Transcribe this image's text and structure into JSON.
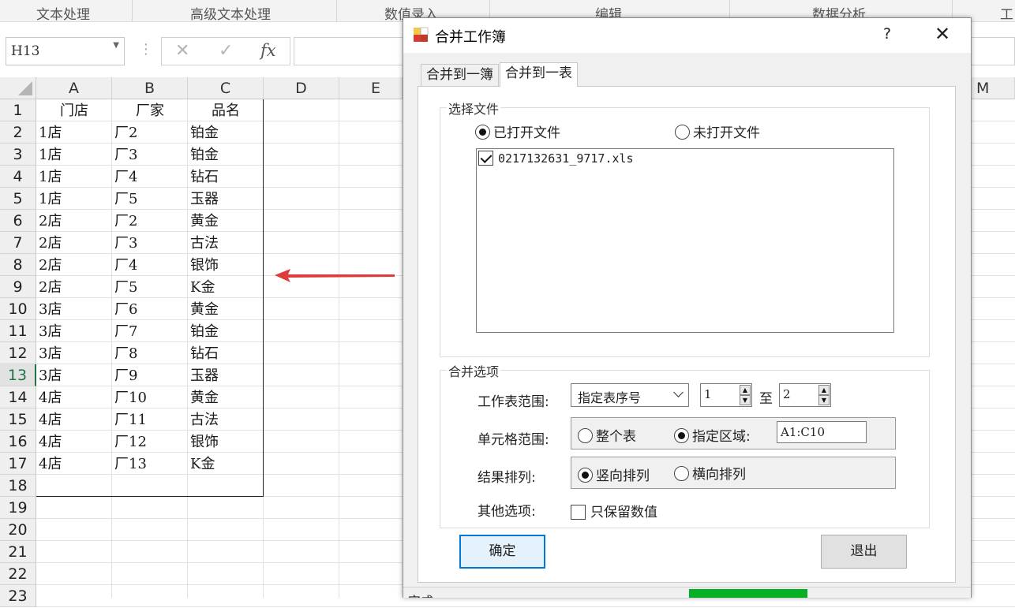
{
  "ribbon": {
    "tabs": [
      "文本处理",
      "高级文本处理",
      "数值录入",
      "编辑",
      "数据分析",
      "工"
    ]
  },
  "formula_bar": {
    "name_box": "H13",
    "cancel_glyph": "✕",
    "enter_glyph": "✓",
    "fx_label": "fx",
    "formula_value": ""
  },
  "sheet": {
    "columns": [
      "A",
      "B",
      "C",
      "D",
      "E",
      "M"
    ],
    "rows": [
      "1",
      "2",
      "3",
      "4",
      "5",
      "6",
      "7",
      "8",
      "9",
      "10",
      "11",
      "12",
      "13",
      "14",
      "15",
      "16",
      "17",
      "18",
      "19",
      "20",
      "21",
      "22",
      "23"
    ],
    "selected_row": "13",
    "header": [
      "门店",
      "厂家",
      "品名"
    ],
    "data": [
      [
        "1店",
        "厂2",
        "铂金"
      ],
      [
        "1店",
        "厂3",
        "铂金"
      ],
      [
        "1店",
        "厂4",
        "钻石"
      ],
      [
        "1店",
        "厂5",
        "玉器"
      ],
      [
        "2店",
        "厂2",
        "黄金"
      ],
      [
        "2店",
        "厂3",
        "古法"
      ],
      [
        "2店",
        "厂4",
        "银饰"
      ],
      [
        "2店",
        "厂5",
        "K金"
      ],
      [
        "3店",
        "厂6",
        "黄金"
      ],
      [
        "3店",
        "厂7",
        "铂金"
      ],
      [
        "3店",
        "厂8",
        "钻石"
      ],
      [
        "3店",
        "厂9",
        "玉器"
      ],
      [
        "4店",
        "厂10",
        "黄金"
      ],
      [
        "4店",
        "厂11",
        "古法"
      ],
      [
        "4店",
        "厂12",
        "银饰"
      ],
      [
        "4店",
        "厂13",
        "K金"
      ]
    ],
    "arrow_color": "#e03b3b"
  },
  "dialog": {
    "title": "合并工作簿",
    "help": "?",
    "close": "✕",
    "tabs": [
      "合并到一簿",
      "合并到一表"
    ],
    "active_tab": 1,
    "select_file": {
      "legend": "选择文件",
      "opt_open": "已打开文件",
      "opt_closed": "未打开文件",
      "selected": "opt_open",
      "files": [
        {
          "name": "0217132631_9717.xls",
          "checked": true
        }
      ]
    },
    "merge_options": {
      "legend": "合并选项",
      "sheet_range_label": "工作表范围:",
      "sheet_range_mode": "指定表序号",
      "from": "1",
      "to_label": "至",
      "to": "2",
      "cell_range_label": "单元格范围:",
      "opt_whole": "整个表",
      "opt_area": "指定区域:",
      "area_value": "A1:C10",
      "cell_selected": "opt_area",
      "result_label": "结果排列:",
      "opt_vertical": "竖向排列",
      "opt_horizontal": "横向排列",
      "result_selected": "opt_vertical",
      "other_label": "其他选项:",
      "keep_values": "只保留数值",
      "keep_values_checked": false
    },
    "ok": "确定",
    "exit": "退出",
    "status_text": "完成",
    "progress_color": "#06b025"
  }
}
